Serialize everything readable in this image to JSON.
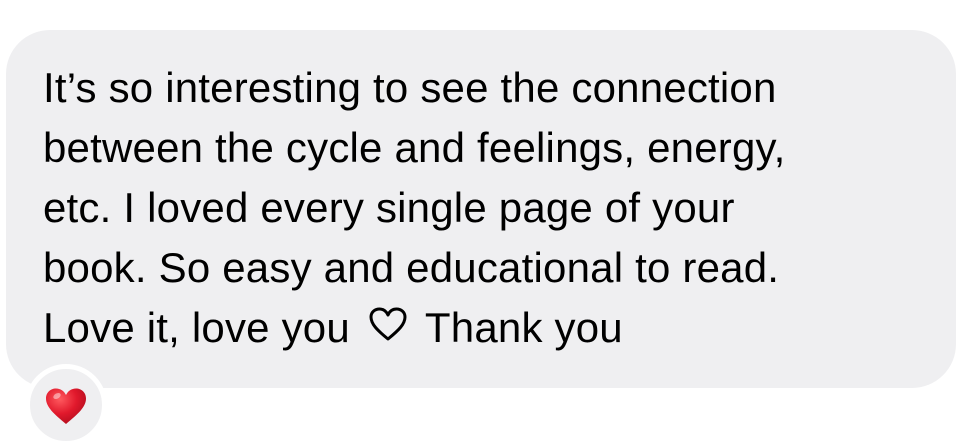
{
  "message": {
    "lines": [
      "It’s so interesting to see the connection",
      "between the cycle and feelings, energy,",
      "etc. I loved every single page of your",
      "book. So easy and educational to read.",
      "Love it, love you"
    ],
    "line5_after_heart": "Thank you",
    "inline_icon": "heart-outline-icon"
  },
  "reaction": {
    "icon": "red-heart-icon",
    "color": "#e1192c"
  },
  "colors": {
    "bubble": "#efeff1",
    "text": "#000000",
    "background": "#ffffff"
  }
}
